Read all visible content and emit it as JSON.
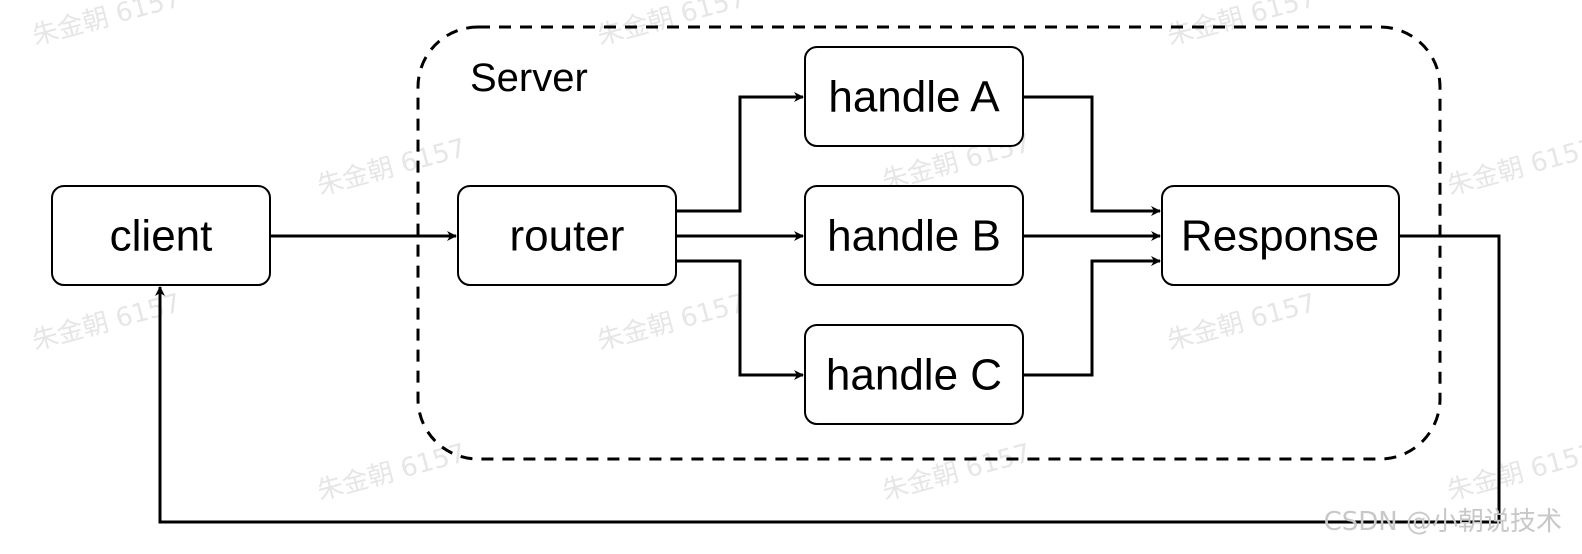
{
  "diagram": {
    "container": {
      "label": "Server"
    },
    "nodes": {
      "client": "client",
      "router": "router",
      "handle_a": "handle A",
      "handle_b": "handle B",
      "handle_c": "handle C",
      "response": "Response"
    },
    "edges": [
      {
        "from": "client",
        "to": "router"
      },
      {
        "from": "router",
        "to": "handle A"
      },
      {
        "from": "router",
        "to": "handle B"
      },
      {
        "from": "router",
        "to": "handle C"
      },
      {
        "from": "handle A",
        "to": "Response"
      },
      {
        "from": "handle B",
        "to": "Response"
      },
      {
        "from": "handle C",
        "to": "Response"
      },
      {
        "from": "Response",
        "to": "client"
      }
    ]
  },
  "watermark": "朱金朝 6157",
  "footer": "CSDN @小朝说技术"
}
